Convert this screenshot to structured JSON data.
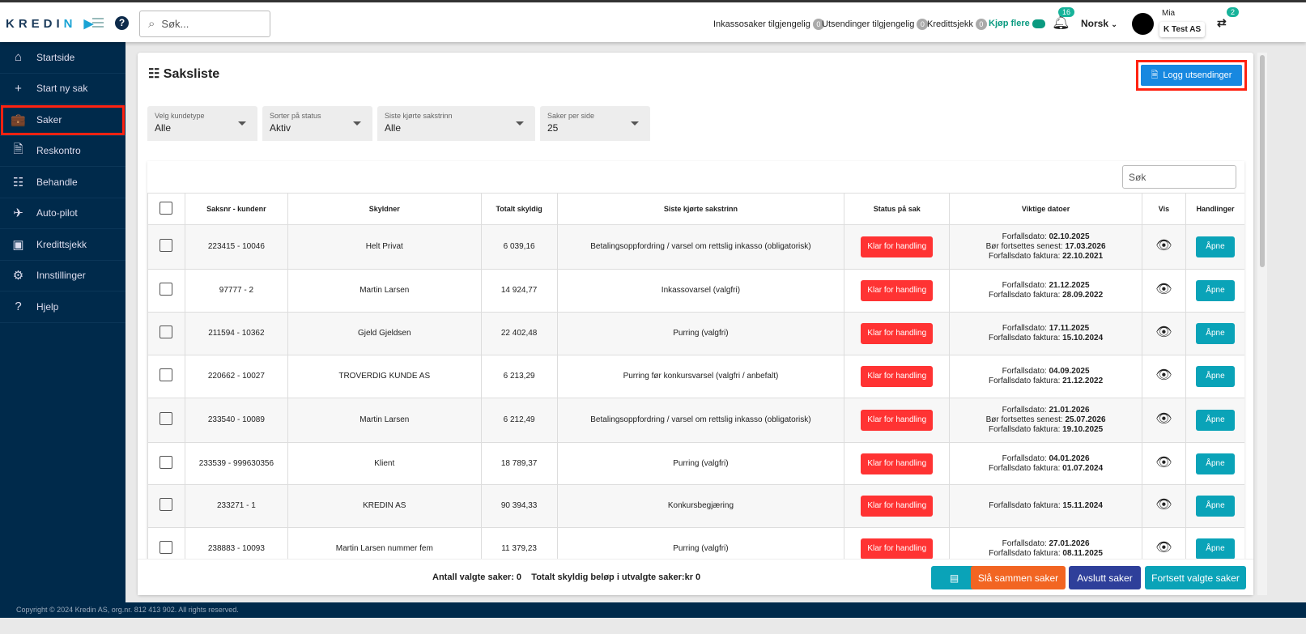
{
  "header": {
    "logo": "KREDIN",
    "search_placeholder": "Søk...",
    "stats": [
      {
        "label": "Inkassosaker tilgjengelig",
        "count": "0"
      },
      {
        "label": "Utsendinger tilgjengelig",
        "count": "0"
      },
      {
        "label": "Kredittsjekk",
        "count": "0"
      }
    ],
    "buy_more": "Kjøp flere",
    "notifications": "16",
    "language": "Norsk",
    "user_name": "Mia",
    "company": "K Test AS",
    "switch_badge": "2"
  },
  "sidebar": {
    "items": [
      {
        "label": "Startside",
        "icon": "⌂"
      },
      {
        "label": "Start ny sak",
        "icon": "+"
      },
      {
        "label": "Saker",
        "icon": "💼"
      },
      {
        "label": "Reskontro",
        "icon": "🗎"
      },
      {
        "label": "Behandle",
        "icon": "☷"
      },
      {
        "label": "Auto-pilot",
        "icon": "✈"
      },
      {
        "label": "Kredittsjekk",
        "icon": "▣"
      },
      {
        "label": "Innstillinger",
        "icon": "⚙"
      },
      {
        "label": "Hjelp",
        "icon": "?"
      }
    ],
    "selected": "Saker"
  },
  "page": {
    "title": "Saksliste",
    "logg_button": "Logg utsendinger"
  },
  "filters": [
    {
      "label": "Velg kundetype",
      "value": "Alle"
    },
    {
      "label": "Sorter på status",
      "value": "Aktiv"
    },
    {
      "label": "Siste kjørte sakstrinn",
      "value": "Alle"
    },
    {
      "label": "Saker per side",
      "value": "25"
    }
  ],
  "table": {
    "search_placeholder": "Søk",
    "headers": [
      "Saksnr - kundenr",
      "Skyldner",
      "Totalt skyldig",
      "Siste kjørte sakstrinn",
      "Status på sak",
      "Viktige datoer",
      "Vis",
      "Handlinger"
    ],
    "rows": [
      {
        "saksnr": "223415 - 10046",
        "skyldner": "Helt Privat",
        "total": "6 039,16",
        "trinn": "Betalingsoppfordring / varsel om rettslig inkasso (obligatorisk)",
        "status": "Klar for handling",
        "dates": [
          [
            "Forfallsdato:",
            "02.10.2025"
          ],
          [
            "Bør fortsettes senest:",
            "17.03.2026"
          ],
          [
            "Forfallsdato faktura:",
            "22.10.2021"
          ]
        ],
        "action": "Åpne"
      },
      {
        "saksnr": "97777 - 2",
        "skyldner": "Martin Larsen",
        "total": "14 924,77",
        "trinn": "Inkassovarsel (valgfri)",
        "status": "Klar for handling",
        "dates": [
          [
            "Forfallsdato:",
            "21.12.2025"
          ],
          [
            "Forfallsdato faktura:",
            "28.09.2022"
          ]
        ],
        "action": "Åpne"
      },
      {
        "saksnr": "211594 - 10362",
        "skyldner": "Gjeld Gjeldsen",
        "total": "22 402,48",
        "trinn": "Purring (valgfri)",
        "status": "Klar for handling",
        "dates": [
          [
            "Forfallsdato:",
            "17.11.2025"
          ],
          [
            "Forfallsdato faktura:",
            "15.10.2024"
          ]
        ],
        "action": "Åpne"
      },
      {
        "saksnr": "220662 - 10027",
        "skyldner": "TROVERDIG KUNDE AS",
        "total": "6 213,29",
        "trinn": "Purring før konkursvarsel (valgfri / anbefalt)",
        "status": "Klar for handling",
        "dates": [
          [
            "Forfallsdato:",
            "04.09.2025"
          ],
          [
            "Forfallsdato faktura:",
            "21.12.2022"
          ]
        ],
        "action": "Åpne"
      },
      {
        "saksnr": "233540 - 10089",
        "skyldner": "Martin Larsen",
        "total": "6 212,49",
        "trinn": "Betalingsoppfordring / varsel om rettslig inkasso (obligatorisk)",
        "status": "Klar for handling",
        "dates": [
          [
            "Forfallsdato:",
            "21.01.2026"
          ],
          [
            "Bør fortsettes senest:",
            "25.07.2026"
          ],
          [
            "Forfallsdato faktura:",
            "19.10.2025"
          ]
        ],
        "action": "Åpne"
      },
      {
        "saksnr": "233539 - 999630356",
        "skyldner": "Klient",
        "total": "18 789,37",
        "trinn": "Purring (valgfri)",
        "status": "Klar for handling",
        "dates": [
          [
            "Forfallsdato:",
            "04.01.2026"
          ],
          [
            "Forfallsdato faktura:",
            "01.07.2024"
          ]
        ],
        "action": "Åpne"
      },
      {
        "saksnr": "233271 - 1",
        "skyldner": "KREDIN AS",
        "total": "90 394,33",
        "trinn": "Konkursbegjæring",
        "status": "Klar for handling",
        "dates": [
          [
            "Forfallsdato faktura:",
            "15.11.2024"
          ]
        ],
        "action": "Åpne"
      },
      {
        "saksnr": "238883 - 10093",
        "skyldner": "Martin Larsen nummer fem",
        "total": "11 379,23",
        "trinn": "Purring (valgfri)",
        "status": "Klar for handling",
        "dates": [
          [
            "Forfallsdato:",
            "27.01.2026"
          ],
          [
            "Forfallsdato faktura:",
            "08.11.2025"
          ]
        ],
        "action": "Åpne"
      }
    ]
  },
  "bottom": {
    "selected_count_label": "Antall valgte saker: 0",
    "total_label": "Totalt skyldig beløp i utvalgte saker:kr 0",
    "merge": "Slå sammen saker",
    "close": "Avslutt saker",
    "continue": "Fortsett valgte saker"
  },
  "footer": "Copyright © 2024 Kredin AS, org.nr. 812 413 902. All rights reserved.",
  "colors": {
    "sidebar": "#002a4b",
    "danger": "#f33333",
    "teal": "#0aa3b8",
    "orange": "#f26522",
    "navy": "#2e3f9a",
    "primary": "#1788e0"
  }
}
